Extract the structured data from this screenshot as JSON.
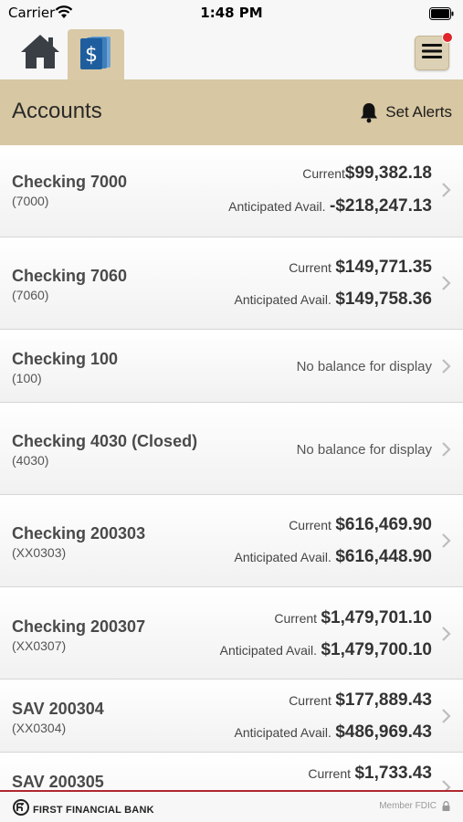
{
  "status_bar": {
    "carrier": "Carrier",
    "time": "1:48 PM"
  },
  "header": {
    "title": "Accounts",
    "alerts_label": "Set Alerts"
  },
  "accounts": [
    {
      "name": "Checking 7000",
      "number": "(7000)",
      "current_label": "Current",
      "current": "$99,382.18",
      "avail_label": "Anticipated Avail.",
      "avail": "-$218,247.13"
    },
    {
      "name": "Checking 7060",
      "number": "(7060)",
      "current_label": "Current",
      "current": "$149,771.35",
      "avail_label": "Anticipated Avail.",
      "avail": "$149,758.36"
    },
    {
      "name": "Checking 100",
      "number": "(100)",
      "no_balance": "No balance for display"
    },
    {
      "name": "Checking 4030 (Closed)",
      "number": "(4030)",
      "no_balance": "No balance for display"
    },
    {
      "name": "Checking 200303",
      "number": "(XX0303)",
      "current_label": "Current",
      "current": "$616,469.90",
      "avail_label": "Anticipated Avail.",
      "avail": "$616,448.90"
    },
    {
      "name": "Checking 200307",
      "number": "(XX0307)",
      "current_label": "Current",
      "current": "$1,479,701.10",
      "avail_label": "Anticipated Avail.",
      "avail": "$1,479,700.10"
    },
    {
      "name": "SAV 200304",
      "number": "(XX0304)",
      "current_label": "Current",
      "current": "$177,889.43",
      "avail_label": "Anticipated Avail.",
      "avail": "$486,969.43"
    },
    {
      "name": "SAV 200305",
      "current_label": "Current",
      "current": "$1,733.43"
    }
  ],
  "footer": {
    "bank_name": "FIRST FINANCIAL BANK",
    "fdic": "Member FDIC"
  },
  "icons": {
    "home": "home-icon",
    "accounts": "dollar-cards-icon",
    "menu": "hamburger-menu-icon",
    "bell": "bell-icon",
    "chevron": "chevron-right-icon",
    "lock": "lock-icon",
    "wifi": "wifi-icon",
    "battery": "battery-icon"
  },
  "colors": {
    "header_bg": "#d7c7a2",
    "active_tab": "#d9c9a6",
    "accent_blue": "#1f5e9e",
    "footer_line": "#b0272e",
    "notify": "#e0262c"
  }
}
